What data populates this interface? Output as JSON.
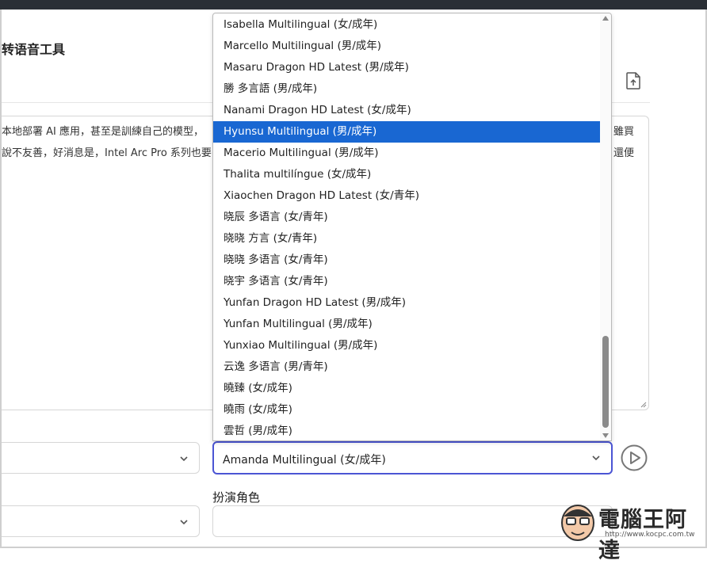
{
  "page": {
    "title": "转语音工具"
  },
  "text_input": {
    "lines": [
      "本地部署 AI 應用，甚至是訓練自己的模型，",
      "說不友善，好消息是，Intel Arc Pro 系列也要"
    ],
    "overflow_right": [
      "雖買",
      "還便"
    ]
  },
  "voice_select": {
    "value": "Amanda Multilingual (女/成年)",
    "options": [
      "Isabella Multilingual (女/成年)",
      "Marcello Multilingual (男/成年)",
      "Masaru Dragon HD Latest (男/成年)",
      "勝 多言語 (男/成年)",
      "Nanami Dragon HD Latest (女/成年)",
      "Hyunsu Multilingual (男/成年)",
      "Macerio Multilingual (男/成年)",
      "Thalita multilíngue (女/成年)",
      "Xiaochen Dragon HD Latest (女/青年)",
      "晓辰 多语言 (女/青年)",
      "晓晓 方言 (女/青年)",
      "晓晓 多语言 (女/青年)",
      "晓宇 多语言 (女/青年)",
      "Yunfan Dragon HD Latest (男/成年)",
      "Yunfan Multilingual (男/成年)",
      "Yunxiao Multilingual (男/成年)",
      "云逸 多语言 (男/青年)",
      "曉臻 (女/成年)",
      "曉雨 (女/成年)",
      "雲哲 (男/成年)"
    ],
    "highlighted_index": 5
  },
  "role": {
    "label": "扮演角色"
  },
  "watermark": {
    "brand": "電腦王阿達",
    "url": "http://www.kocpc.com.tw"
  },
  "icons": {
    "upload": "file-upload-icon",
    "play": "play-circle-icon",
    "chevron": "chevron-down-icon"
  },
  "colors": {
    "accent": "#4b55d4",
    "highlight": "#1967d2"
  }
}
